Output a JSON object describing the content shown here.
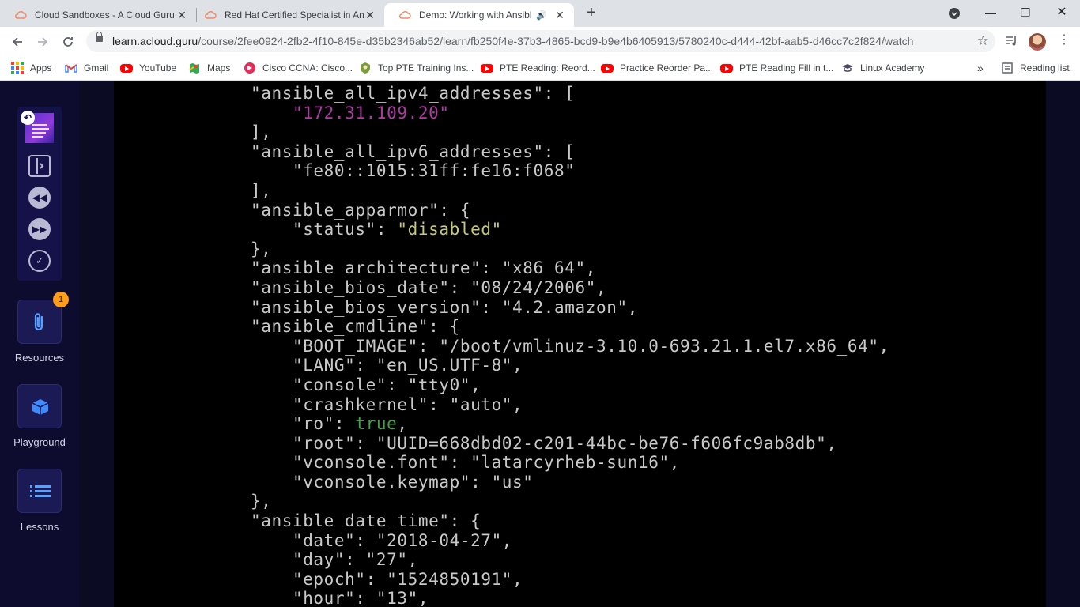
{
  "browser": {
    "tabs": [
      {
        "title": "Cloud Sandboxes - A Cloud Guru",
        "active": false
      },
      {
        "title": "Red Hat Certified Specialist in An",
        "active": false
      },
      {
        "title": "Demo: Working with Ansible",
        "active": true
      }
    ],
    "url_host": "learn.acloud.guru",
    "url_path": "/course/2fee0924-2fb2-4f10-845e-d35b2346ab52/learn/fb250f4e-37b3-4865-bcd9-b9e4b6405913/5780240c-d444-42bf-aab5-d46cc7c2f824/watch",
    "bookmarks": [
      {
        "label": "Apps",
        "icon": "apps-grid-icon"
      },
      {
        "label": "Gmail",
        "icon": "gmail-icon"
      },
      {
        "label": "YouTube",
        "icon": "youtube-icon"
      },
      {
        "label": "Maps",
        "icon": "maps-icon"
      },
      {
        "label": "Cisco CCNA: Cisco...",
        "icon": "cisco-icon"
      },
      {
        "label": "Top PTE Training Ins...",
        "icon": "pte-training-icon"
      },
      {
        "label": "PTE Reading: Reord...",
        "icon": "youtube-icon"
      },
      {
        "label": "Practice Reorder Pa...",
        "icon": "youtube-icon"
      },
      {
        "label": "PTE Reading Fill in t...",
        "icon": "youtube-icon"
      },
      {
        "label": "Linux Academy",
        "icon": "graduation-cap-icon"
      }
    ],
    "more_bookmarks": "»",
    "reading_list": "Reading list"
  },
  "sidebar": {
    "resources_label": "Resources",
    "resources_badge": "1",
    "playground_label": "Playground",
    "lessons_label": "Lessons"
  },
  "terminal": {
    "lines": [
      [
        {
          "t": "    \"ansible_all_ipv4_addresses\": ["
        }
      ],
      [
        {
          "t": "        "
        },
        {
          "t": "\"172.31.109.20\"",
          "c": "mg"
        }
      ],
      [
        {
          "t": "    ],"
        }
      ],
      [
        {
          "t": "    \"ansible_all_ipv6_addresses\": ["
        }
      ],
      [
        {
          "t": "        \"fe80::1015:31ff:fe16:f068\""
        }
      ],
      [
        {
          "t": "    ],"
        }
      ],
      [
        {
          "t": "    \"ansible_apparmor\": {"
        }
      ],
      [
        {
          "t": "        \"status\": "
        },
        {
          "t": "\"disabled\"",
          "c": "ye"
        }
      ],
      [
        {
          "t": "    },"
        }
      ],
      [
        {
          "t": "    \"ansible_architecture\": \"x86_64\","
        }
      ],
      [
        {
          "t": "    \"ansible_bios_date\": \"08/24/2006\","
        }
      ],
      [
        {
          "t": "    \"ansible_bios_version\": \"4.2.amazon\","
        }
      ],
      [
        {
          "t": "    \"ansible_cmdline\": {"
        }
      ],
      [
        {
          "t": "        \"BOOT_IMAGE\": \"/boot/vmlinuz-3.10.0-693.21.1.el7.x86_64\","
        }
      ],
      [
        {
          "t": "        \"LANG\": \"en_US.UTF-8\","
        }
      ],
      [
        {
          "t": "        \"console\": \"tty0\","
        }
      ],
      [
        {
          "t": "        \"crashkernel\": \"auto\","
        }
      ],
      [
        {
          "t": "        \"ro\": "
        },
        {
          "t": "true",
          "c": "gr"
        },
        {
          "t": ","
        }
      ],
      [
        {
          "t": "        \"root\": \"UUID=668dbd02-c201-44bc-be76-f606fc9ab8db\","
        }
      ],
      [
        {
          "t": "        \"vconsole.font\": \"latarcyrheb-sun16\","
        }
      ],
      [
        {
          "t": "        \"vconsole.keymap\": \"us\""
        }
      ],
      [
        {
          "t": "    },"
        }
      ],
      [
        {
          "t": "    \"ansible_date_time\": {"
        }
      ],
      [
        {
          "t": "        \"date\": \"2018-04-27\","
        }
      ],
      [
        {
          "t": "        \"day\": \"27\","
        }
      ],
      [
        {
          "t": "        \"epoch\": \"1524850191\","
        }
      ],
      [
        {
          "t": "        \"hour\": \"13\","
        }
      ]
    ]
  },
  "colors": {
    "accent": "#15124a",
    "badge": "#ff9c1a",
    "term_magenta": "#b03aa6",
    "term_yellow": "#c8c87a",
    "term_green": "#43a047"
  }
}
